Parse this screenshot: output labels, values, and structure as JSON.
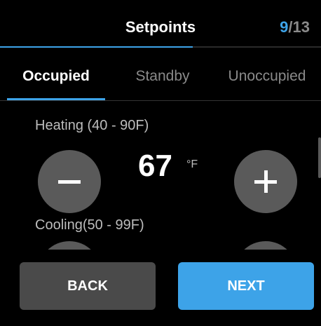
{
  "header": {
    "title": "Setpoints",
    "page_current": "9",
    "page_separator": "/",
    "page_total": "13",
    "progress": 0.6
  },
  "tabs": [
    {
      "label": "Occupied",
      "active": true
    },
    {
      "label": "Standby",
      "active": false
    },
    {
      "label": "Unoccupied",
      "active": false
    }
  ],
  "heating": {
    "label": "Heating (40 - 90F)",
    "value": "67",
    "unit": "°F"
  },
  "cooling": {
    "label": "Cooling(50 - 99F)"
  },
  "footer": {
    "back_label": "BACK",
    "next_label": "NEXT"
  },
  "colors": {
    "accent": "#3da3e8",
    "button_gray": "#5a5a5a",
    "background": "#000000"
  },
  "icons": {
    "decrease": "minus-icon",
    "increase": "plus-icon"
  }
}
